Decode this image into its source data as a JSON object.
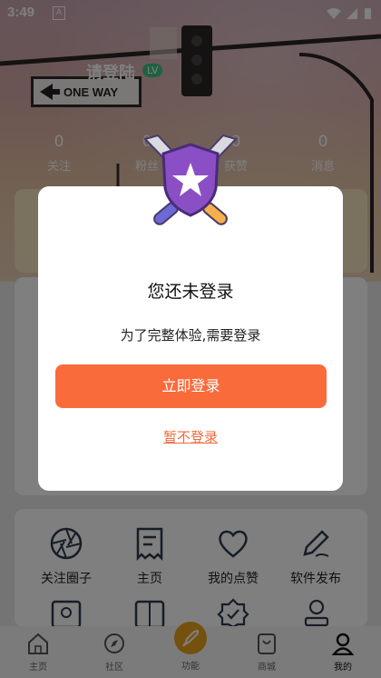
{
  "status": {
    "time": "3:49"
  },
  "profile": {
    "name": "请登陆",
    "level_badge": "LV"
  },
  "stats": [
    {
      "value": "0",
      "label": "关注"
    },
    {
      "value": "0",
      "label": "粉丝"
    },
    {
      "value": "0",
      "label": "获赞"
    },
    {
      "value": "0",
      "label": "消息"
    }
  ],
  "modal": {
    "title": "您还未登录",
    "message": "为了完整体验,需要登录",
    "login_label": "立即登录",
    "skip_label": "暂不登录"
  },
  "grid": [
    {
      "label": "关注圈子",
      "icon": "aperture-icon"
    },
    {
      "label": "主页",
      "icon": "receipt-icon"
    },
    {
      "label": "我的点赞",
      "icon": "heart-icon"
    },
    {
      "label": "软件发布",
      "icon": "pen-icon"
    }
  ],
  "tabs": [
    {
      "label": "主页",
      "icon": "home-icon"
    },
    {
      "label": "社区",
      "icon": "compass-icon"
    },
    {
      "label": "功能",
      "icon": "rocket-icon"
    },
    {
      "label": "商城",
      "icon": "shop-icon"
    },
    {
      "label": "我的",
      "icon": "person-icon"
    }
  ],
  "colors": {
    "accent": "#fa6b3c",
    "badge": "#3cc47c",
    "rocket": "#e8a21a"
  }
}
